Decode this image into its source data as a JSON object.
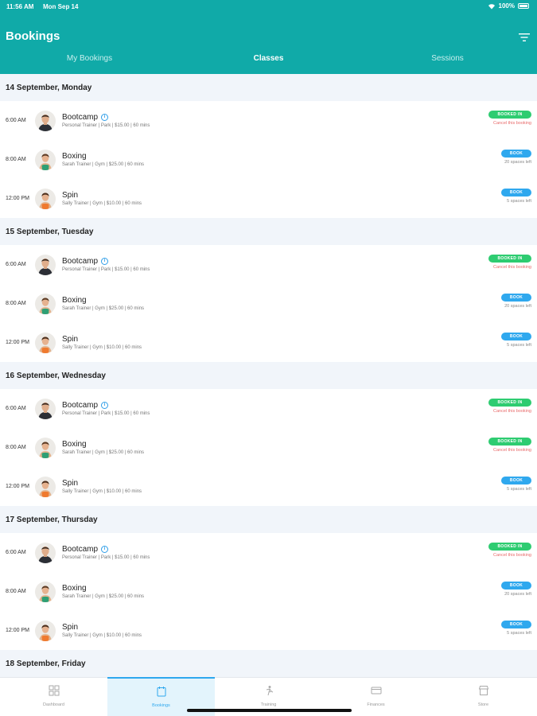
{
  "status": {
    "time": "11:56 AM",
    "date": "Mon Sep 14",
    "battery": "100%"
  },
  "header": {
    "title": "Bookings"
  },
  "tabs": [
    {
      "label": "My Bookings",
      "active": false
    },
    {
      "label": "Classes",
      "active": true
    },
    {
      "label": "Sessions",
      "active": false
    }
  ],
  "days": [
    {
      "label": "14 September, Monday",
      "rows": [
        {
          "time": "6:00 AM",
          "title": "Bootcamp",
          "info": true,
          "subtitle": "Personal Trainer | Park | $15.00 | 60 mins",
          "avatar": "male",
          "status": "booked",
          "badge": "BOOKED IN",
          "note": "Cancel this booking"
        },
        {
          "time": "8:00 AM",
          "title": "Boxing",
          "info": false,
          "subtitle": "Sarah Trainer | Gym | $25.00 | 60 mins",
          "avatar": "female-green",
          "status": "book",
          "badge": "BOOK",
          "note": "20 spaces left"
        },
        {
          "time": "12:00 PM",
          "title": "Spin",
          "info": false,
          "subtitle": "Sally Trainer | Gym | $10.00 | 60 mins",
          "avatar": "female-orange",
          "status": "book",
          "badge": "BOOK",
          "note": "5 spaces left"
        }
      ]
    },
    {
      "label": "15 September, Tuesday",
      "rows": [
        {
          "time": "6:00 AM",
          "title": "Bootcamp",
          "info": true,
          "subtitle": "Personal Trainer | Park | $15.00 | 60 mins",
          "avatar": "male",
          "status": "booked",
          "badge": "BOOKED IN",
          "note": "Cancel this booking"
        },
        {
          "time": "8:00 AM",
          "title": "Boxing",
          "info": false,
          "subtitle": "Sarah Trainer | Gym | $25.00 | 60 mins",
          "avatar": "female-green",
          "status": "book",
          "badge": "BOOK",
          "note": "20 spaces left"
        },
        {
          "time": "12:00 PM",
          "title": "Spin",
          "info": false,
          "subtitle": "Sally Trainer | Gym | $10.00 | 60 mins",
          "avatar": "female-orange",
          "status": "book",
          "badge": "BOOK",
          "note": "5 spaces left"
        }
      ]
    },
    {
      "label": "16 September, Wednesday",
      "rows": [
        {
          "time": "6:00 AM",
          "title": "Bootcamp",
          "info": true,
          "subtitle": "Personal Trainer | Park | $15.00 | 60 mins",
          "avatar": "male",
          "status": "booked",
          "badge": "BOOKED IN",
          "note": "Cancel this booking"
        },
        {
          "time": "8:00 AM",
          "title": "Boxing",
          "info": false,
          "subtitle": "Sarah Trainer | Gym | $25.00 | 60 mins",
          "avatar": "female-green",
          "status": "booked",
          "badge": "BOOKED IN",
          "note": "Cancel this booking"
        },
        {
          "time": "12:00 PM",
          "title": "Spin",
          "info": false,
          "subtitle": "Sally Trainer | Gym | $10.00 | 60 mins",
          "avatar": "female-orange",
          "status": "book",
          "badge": "BOOK",
          "note": "5 spaces left"
        }
      ]
    },
    {
      "label": "17 September, Thursday",
      "rows": [
        {
          "time": "6:00 AM",
          "title": "Bootcamp",
          "info": true,
          "subtitle": "Personal Trainer | Park | $15.00 | 60 mins",
          "avatar": "male",
          "status": "booked",
          "badge": "BOOKED IN",
          "note": "Cancel this booking"
        },
        {
          "time": "8:00 AM",
          "title": "Boxing",
          "info": false,
          "subtitle": "Sarah Trainer | Gym | $25.00 | 60 mins",
          "avatar": "female-green",
          "status": "book",
          "badge": "BOOK",
          "note": "20 spaces left"
        },
        {
          "time": "12:00 PM",
          "title": "Spin",
          "info": false,
          "subtitle": "Sally Trainer | Gym | $10.00 | 60 mins",
          "avatar": "female-orange",
          "status": "book",
          "badge": "BOOK",
          "note": "5 spaces left"
        }
      ]
    },
    {
      "label": "18 September, Friday",
      "rows": []
    }
  ],
  "bottom_nav": [
    {
      "label": "Dashboard",
      "icon": "dashboard-icon",
      "active": false
    },
    {
      "label": "Bookings",
      "icon": "calendar-icon",
      "active": true
    },
    {
      "label": "Training",
      "icon": "training-icon",
      "active": false
    },
    {
      "label": "Finances",
      "icon": "wallet-icon",
      "active": false
    },
    {
      "label": "Store",
      "icon": "store-icon",
      "active": false
    }
  ],
  "colors": {
    "header": "#10aaa8",
    "booked": "#2ecc71",
    "book": "#2fa8ee",
    "cancel": "#e86a6a",
    "day_header_bg": "#f1f5fa"
  }
}
